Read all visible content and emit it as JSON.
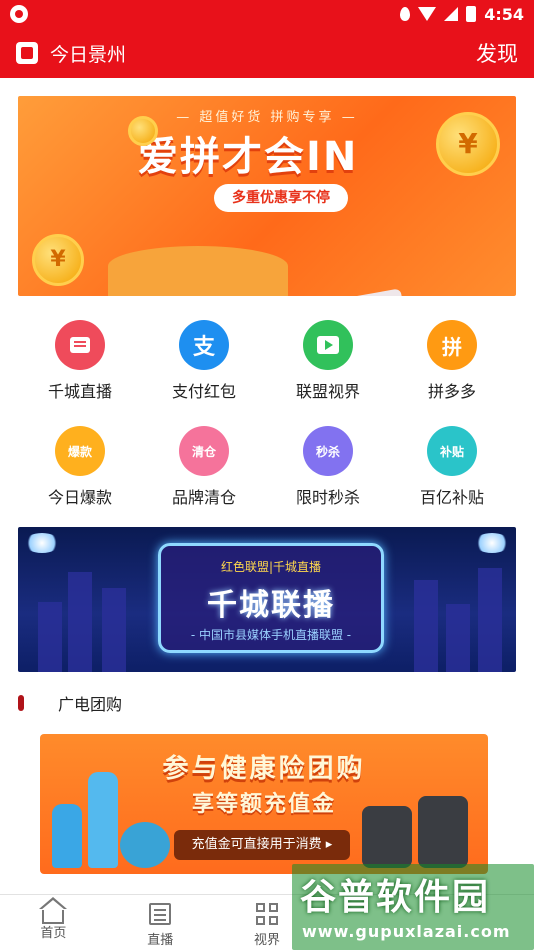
{
  "status_bar": {
    "time": "4:54"
  },
  "app_bar": {
    "title": "今日景州",
    "action": "发现"
  },
  "banner_top": {
    "subtitle": "— 超值好货  拼购专享 —",
    "title": "爱拼才会IN",
    "pill": "多重优惠享不停"
  },
  "grid_items": [
    {
      "label": "千城直播",
      "icon": "news-icon",
      "color": "#ef4b5b"
    },
    {
      "label": "支付红包",
      "icon": "alipay-icon",
      "color": "#1e8ff0",
      "glyph": "支"
    },
    {
      "label": "联盟视界",
      "icon": "tv-play-icon",
      "color": "#31c15b"
    },
    {
      "label": "拼多多",
      "icon": "pinduoduo-icon",
      "color": "#ff9a12",
      "glyph": "拼"
    },
    {
      "label": "今日爆款",
      "icon": "hot-fire-icon",
      "color": "#ffb01e",
      "glyph": "爆款"
    },
    {
      "label": "品牌清仓",
      "icon": "clearance-icon",
      "color": "#f5739b",
      "glyph": "清仓"
    },
    {
      "label": "限时秒杀",
      "icon": "flash-sale-icon",
      "color": "#8272f0",
      "glyph": "秒杀"
    },
    {
      "label": "百亿补贴",
      "icon": "subsidy-icon",
      "color": "#2ac4c9",
      "glyph": "补贴"
    }
  ],
  "banner_live": {
    "subtitle": "红色联盟|千城直播",
    "title": "千城联播",
    "footer": "- 中国市县媒体手机直播联盟 -"
  },
  "section": {
    "title": "广电团购"
  },
  "banner_group": {
    "title": "参与健康险团购",
    "subtitle": "享等额充值金",
    "pill": "充值金可直接用于消费 ▸"
  },
  "tabs": [
    {
      "label": "首页",
      "icon": "home-icon"
    },
    {
      "label": "直播",
      "icon": "document-icon"
    },
    {
      "label": "视界",
      "icon": "grid-icon"
    },
    {
      "label": "",
      "icon": ""
    },
    {
      "label": "",
      "icon": ""
    }
  ],
  "watermark": {
    "title": "谷普软件园",
    "url": "www.gupuxlazai.com"
  }
}
